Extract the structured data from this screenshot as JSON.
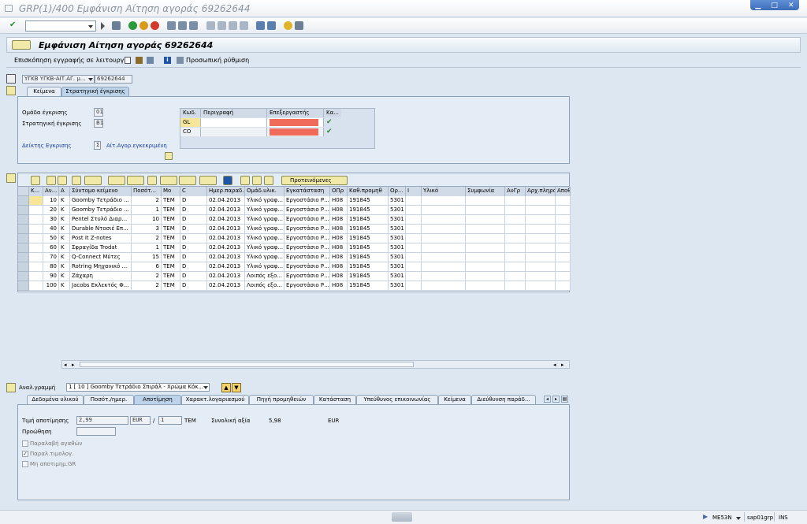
{
  "window": {
    "title": "GRP(1)/400 Εμφάνιση Αίτηση αγοράς 69262644"
  },
  "content": {
    "title": "Εμφάνιση Αίτηση αγοράς 69262644"
  },
  "apptoolbar": {
    "overview": "Επισκόπηση εγγραφής σε λειτουργία",
    "personal": "Προσωπική ρύθμιση"
  },
  "header": {
    "doc_type": "ΥΓΚΒ ΥΓΚΒ-ΑΙΤ.ΑΓ. μ...",
    "doc_number": "69262644"
  },
  "tabs": [
    {
      "label": "Κείμενα"
    },
    {
      "label": "Στρατηγική έγκρισης"
    }
  ],
  "approval": {
    "group_label": "Ομάδα έγκρισης",
    "group_value": "01",
    "strategy_label": "Στρατηγική έγκρισης",
    "strategy_value": "B1",
    "indicator_label": "Δείκτης Εγκρισης",
    "indicator_value": "Σ",
    "indicator_text": "Αίτ.Αγορ.εγκεκριμένη",
    "columns": [
      "Κωδ.",
      "Περιγραφή",
      "Επεξεργαστής",
      "Κα..."
    ],
    "rows": [
      {
        "code": "GL",
        "check": "✔"
      },
      {
        "code": "CO",
        "check": "✔"
      }
    ]
  },
  "grid_toolbar": {
    "proposed": "Προτεινόμενες τιμές"
  },
  "grid": {
    "columns": [
      "Κ...",
      "Αν...",
      "Α",
      "Σύντομο κείμενο",
      "Ποσότ...",
      "Μο",
      "C",
      "Ημερ.παραδ.",
      "Ομάδ.υλικ.",
      "Εγκατάσταση",
      "ΟΠρ",
      "Καθ.προμηθ",
      "Ορ...",
      "Ι",
      "Υλικό",
      "Συμφωνία",
      "ΑνΓρ",
      "Αρχ.πληροφ",
      "Αποθ."
    ],
    "rows": [
      [
        "",
        "10",
        "K",
        "Goomby Τετράδιο ...",
        "2",
        "TEM",
        "D",
        "02.04.2013",
        "Υλικό γραφ...",
        "Εργοστάσιο Ρ...",
        "H08",
        "191845",
        "5301"
      ],
      [
        "",
        "20",
        "K",
        "Goomby Τετράδιο ...",
        "1",
        "TEM",
        "D",
        "02.04.2013",
        "Υλικό γραφ...",
        "Εργοστάσιο Ρ...",
        "H08",
        "191845",
        "5301"
      ],
      [
        "",
        "30",
        "K",
        "Pentel Στυλό Διαρ...",
        "10",
        "TEM",
        "D",
        "02.04.2013",
        "Υλικό γραφ...",
        "Εργοστάσιο Ρ...",
        "H08",
        "191845",
        "5301"
      ],
      [
        "",
        "40",
        "K",
        "Durable Ντοσιέ Επ...",
        "3",
        "TEM",
        "D",
        "02.04.2013",
        "Υλικό γραφ...",
        "Εργοστάσιο Ρ...",
        "H08",
        "191845",
        "5301"
      ],
      [
        "",
        "50",
        "K",
        "Post It Z-notes",
        "2",
        "TEM",
        "D",
        "02.04.2013",
        "Υλικό γραφ...",
        "Εργοστάσιο Ρ...",
        "H08",
        "191845",
        "5301"
      ],
      [
        "",
        "60",
        "K",
        "Σφραγίδα Trodat",
        "1",
        "TEM",
        "D",
        "02.04.2013",
        "Υλικό γραφ...",
        "Εργοστάσιο Ρ...",
        "H08",
        "191845",
        "5301"
      ],
      [
        "",
        "70",
        "K",
        "Q-Connect Μύτες",
        "15",
        "TEM",
        "D",
        "02.04.2013",
        "Υλικό γραφ...",
        "Εργοστάσιο Ρ...",
        "H08",
        "191845",
        "5301"
      ],
      [
        "",
        "80",
        "K",
        "Rotring Μηχανικό ...",
        "6",
        "TEM",
        "D",
        "02.04.2013",
        "Υλικό γραφ...",
        "Εργοστάσιο Ρ...",
        "H08",
        "191845",
        "5301"
      ],
      [
        "",
        "90",
        "K",
        "Ζάχαρη",
        "2",
        "TEM",
        "D",
        "02.04.2013",
        "Λοιπός εξο...",
        "Εργοστάσιο Ρ...",
        "H08",
        "191845",
        "5301"
      ],
      [
        "",
        "100",
        "K",
        "Jacobs Εκλεκτός Φ...",
        "2",
        "TEM",
        "D",
        "02.04.2013",
        "Λοιπός εξο...",
        "Εργοστάσιο Ρ...",
        "H08",
        "191845",
        "5301"
      ]
    ]
  },
  "item": {
    "label": "Αναλ.γραμμή",
    "selected": "1 [ 10 ] Goomby Τετράδιο Σπιράλ - Χρώμα Κόκ..."
  },
  "item_tabs": [
    {
      "label": "Δεδομένα υλικού"
    },
    {
      "label": "Ποσότ./ημερ."
    },
    {
      "label": "Αποτίμηση"
    },
    {
      "label": "Χαρακτ.λογαριασμού"
    },
    {
      "label": "Πηγή προμηθειών"
    },
    {
      "label": "Κατάσταση"
    },
    {
      "label": "Υπεύθυνος επικοινωνίας"
    },
    {
      "label": "Κείμενα"
    },
    {
      "label": "Διεύθυνση παράδ..."
    }
  ],
  "valuation": {
    "price_label": "Τιμή αποτίμησης",
    "price": "2,99",
    "currency": "EUR",
    "per": "1",
    "unit": "TEM",
    "total_label": "Συνολική αξία",
    "total": "5,98",
    "total_currency": "EUR",
    "markup_label": "Προώθηση",
    "goods_receipt": "Παραλαβή αγαθών",
    "invoice_receipt": "Παραλ.τιμολογ.",
    "non_valuated": "Μη αποτιμημ.GR"
  },
  "statusbar": {
    "transaction": "ME53N",
    "server": "sap01grp",
    "mode": "INS"
  }
}
